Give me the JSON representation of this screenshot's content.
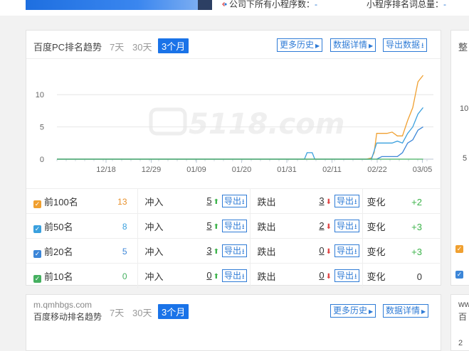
{
  "top": {
    "stat1_label": "公司下所有小程序数：",
    "stat1_value": "-",
    "stat2_label": "小程序排名词总量：",
    "stat2_value": "-"
  },
  "pc_panel": {
    "title": "百度PC排名趋势",
    "tabs": [
      "7天",
      "30天",
      "3个月"
    ],
    "active_tab": "3个月",
    "buttons": {
      "history": "更多历史",
      "detail": "数据详情",
      "export": "导出数据"
    },
    "watermark": "5118.com"
  },
  "chart_data": {
    "type": "line",
    "x_ticks": [
      "12/18",
      "12/29",
      "01/09",
      "01/20",
      "01/31",
      "02/11",
      "02/22",
      "03/05"
    ],
    "y_ticks": [
      0,
      5,
      10
    ],
    "ylim": [
      0,
      13
    ],
    "grid": true,
    "series": [
      {
        "color": "#f0a030",
        "points": [
          [
            0,
            0
          ],
          [
            60,
            0
          ],
          [
            61,
            0.2
          ],
          [
            61.5,
            1
          ],
          [
            62,
            4
          ],
          [
            64,
            4
          ],
          [
            65,
            4.2
          ],
          [
            66,
            3.6
          ],
          [
            67,
            3.6
          ],
          [
            68,
            6
          ],
          [
            69,
            8
          ],
          [
            70,
            12
          ],
          [
            71,
            13
          ]
        ]
      },
      {
        "color": "#3aa0de",
        "points": [
          [
            0,
            0
          ],
          [
            48,
            0
          ],
          [
            48.5,
            1
          ],
          [
            49.5,
            1
          ],
          [
            50,
            0
          ],
          [
            61,
            0
          ],
          [
            62,
            2.5
          ],
          [
            65,
            2.5
          ],
          [
            66,
            2.8
          ],
          [
            67,
            2.5
          ],
          [
            68,
            4
          ],
          [
            69,
            5
          ],
          [
            70,
            7
          ],
          [
            71,
            8
          ]
        ]
      },
      {
        "color": "#3c86d8",
        "points": [
          [
            0,
            0
          ],
          [
            62,
            0
          ],
          [
            63,
            0.4
          ],
          [
            66,
            0.4
          ],
          [
            67,
            1
          ],
          [
            68,
            2.5
          ],
          [
            69,
            3
          ],
          [
            70,
            4.5
          ],
          [
            71,
            5
          ]
        ]
      },
      {
        "color": "#45b060",
        "points": [
          [
            0,
            0
          ],
          [
            71,
            0
          ]
        ]
      }
    ]
  },
  "ranking_rows": [
    {
      "label": "前100名",
      "count": "13",
      "count_color": "#e8902a",
      "box_color": "#f0a030",
      "in_label": "冲入",
      "in_value": "5",
      "out_label": "跌出",
      "out_value": "3",
      "change_label": "变化",
      "change": "+2",
      "change_color": "#3cb34a"
    },
    {
      "label": "前50名",
      "count": "8",
      "count_color": "#3aa0de",
      "box_color": "#3aa0de",
      "in_label": "冲入",
      "in_value": "5",
      "out_label": "跌出",
      "out_value": "2",
      "change_label": "变化",
      "change": "+3",
      "change_color": "#3cb34a"
    },
    {
      "label": "前20名",
      "count": "5",
      "count_color": "#3c86d8",
      "box_color": "#3c86d8",
      "in_label": "冲入",
      "in_value": "3",
      "out_label": "跌出",
      "out_value": "0",
      "change_label": "变化",
      "change": "+3",
      "change_color": "#3cb34a"
    },
    {
      "label": "前10名",
      "count": "0",
      "count_color": "#45b060",
      "box_color": "#45b060",
      "in_label": "冲入",
      "in_value": "0",
      "out_label": "跌出",
      "out_value": "0",
      "change_label": "变化",
      "change": "0",
      "change_color": "#333333"
    }
  ],
  "export_label": "导出",
  "mobile_panel": {
    "site": "m.qmhbgs.com",
    "title": "百度移动排名趋势",
    "tabs": [
      "7天",
      "30天",
      "3个月"
    ],
    "active_tab": "3个月",
    "buttons": {
      "history": "更多历史",
      "detail": "数据详情"
    }
  },
  "side_panel": {
    "title_fragment": "整",
    "ticks": [
      "10",
      "5"
    ],
    "bottom_fragment_1": "ww",
    "bottom_fragment_2": "百",
    "bottom_tick": "2"
  }
}
